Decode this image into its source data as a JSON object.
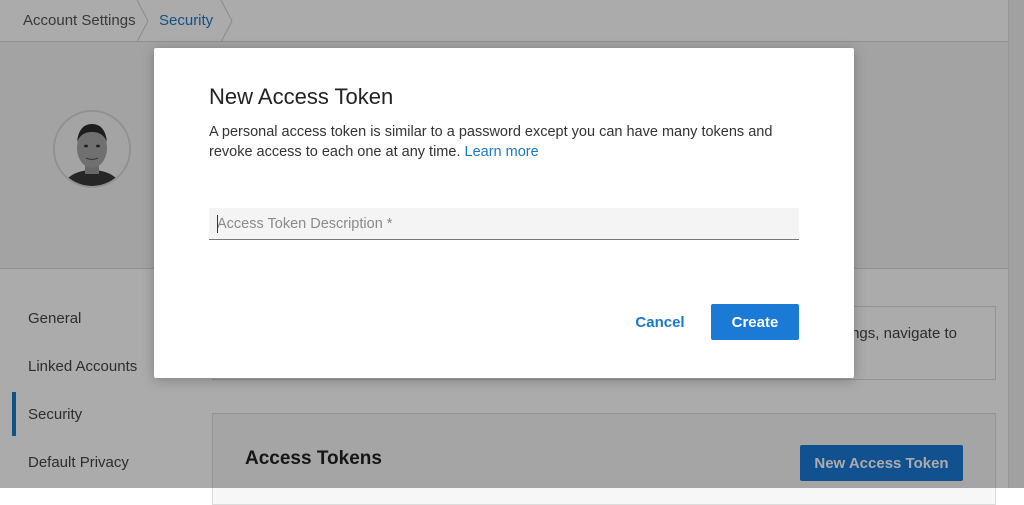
{
  "breadcrumb": {
    "items": [
      {
        "label": "Account Settings"
      },
      {
        "label": "Security"
      }
    ]
  },
  "profile": {
    "avatar_icon": "user-avatar"
  },
  "sidebar": {
    "items": [
      {
        "label": "General"
      },
      {
        "label": "Linked Accounts"
      },
      {
        "label": "Security",
        "active": true
      },
      {
        "label": "Default Privacy"
      }
    ]
  },
  "info_card": {
    "text": "ngs, navigate to"
  },
  "access_tokens": {
    "title": "Access Tokens",
    "new_button": "New Access Token"
  },
  "modal": {
    "title": "New Access Token",
    "description": "A personal access token is similar to a password except you can have many tokens and revoke access to each one at any time.",
    "learn_more": "Learn more",
    "input": {
      "placeholder": "Access Token Description *",
      "value": ""
    },
    "cancel_label": "Cancel",
    "create_label": "Create"
  },
  "colors": {
    "accent": "#1a79c7",
    "primary_button": "#1a7ad6",
    "overlay": "rgba(0,0,0,0.33)"
  }
}
